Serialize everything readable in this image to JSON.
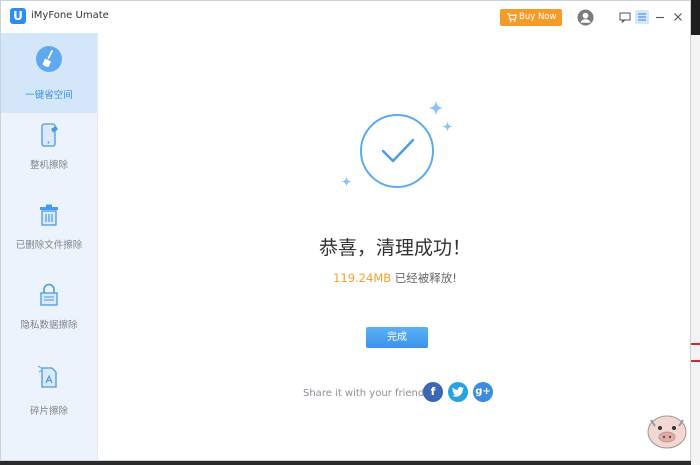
{
  "app": {
    "title": "iMyFone Umate",
    "logo_letter": "U"
  },
  "titlebar": {
    "buy_now": "Buy Now"
  },
  "sidebar": {
    "items": [
      {
        "label": "一键省空间",
        "icon": "broom-icon",
        "active": true
      },
      {
        "label": "整机擦除",
        "icon": "phone-erase-icon",
        "active": false
      },
      {
        "label": "已删除文件擦除",
        "icon": "trash-icon",
        "active": false
      },
      {
        "label": "隐私数据擦除",
        "icon": "lock-icon",
        "active": false
      },
      {
        "label": "碎片擦除",
        "icon": "file-fragment-icon",
        "active": false
      }
    ]
  },
  "main": {
    "headline": "恭喜，清理成功！",
    "freed_size": "119.24MB",
    "freed_suffix": " 已经被释放!",
    "done_button": "完成",
    "share_text": "Share it with your friends:"
  },
  "social": {
    "facebook": "f",
    "twitter": "t",
    "google": "g+"
  },
  "colors": {
    "accent": "#3a8ee6",
    "orange": "#f39c2a",
    "sidebar_bg": "#ecf3fc",
    "active_bg": "#d4e6fa"
  }
}
